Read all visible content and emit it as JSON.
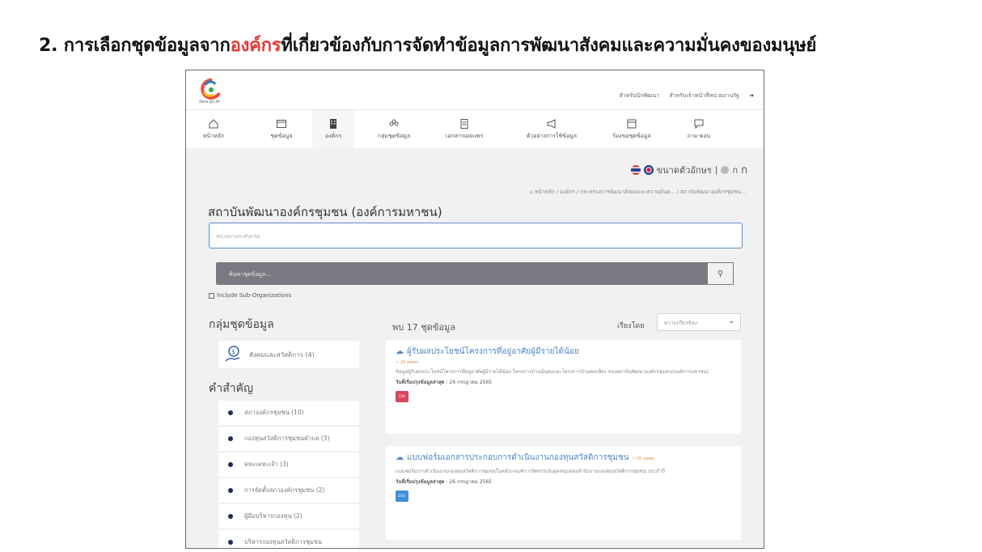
{
  "slide": {
    "title_prefix": "2. การเลือกชุดข้อมูลจาก",
    "title_highlight": "องค์กร",
    "title_suffix": "ที่เกี่ยวข้องกับการจัดทำข้อมูลการพัฒนาสังคมและความมั่นคงของมนุษย์",
    "highlight_color": "#e53935"
  },
  "site": {
    "logo_text": "data.go.th",
    "top_links": [
      "สำหรับนักพัฒนา",
      "สำหรับเจ้าหน้าที่หน่วยงานรัฐ"
    ]
  },
  "nav": {
    "items": [
      {
        "label": "หน้าหลัก",
        "icon": "home-icon"
      },
      {
        "label": "ชุดข้อมูล",
        "icon": "dataset-icon"
      },
      {
        "label": "องค์กร",
        "icon": "building-icon"
      },
      {
        "label": "กลุ่มชุดข้อมูล",
        "icon": "group-icon"
      },
      {
        "label": "เอกสารเผยแพร่",
        "icon": "document-icon"
      },
      {
        "label": "ตัวอย่างการใช้ข้อมูล",
        "icon": "megaphone-icon"
      },
      {
        "label": "ร้องขอชุดข้อมูล",
        "icon": "request-icon"
      },
      {
        "label": "ถาม-ตอบ",
        "icon": "chat-icon"
      }
    ]
  },
  "font_size": {
    "label": "ขนาดตัวอักษร",
    "small": "ก",
    "large": "ก"
  },
  "breadcrumb": [
    "หน้าหลัก",
    "องค์กร",
    "กระทรวงการพัฒนาสังคมและความมั่นค...",
    "สถาบันพัฒนาองค์กรชุมชน..."
  ],
  "org": {
    "title": "สถาบันพัฒนาองค์กรชุมชน (องค์การมหาชน)",
    "agency_placeholder": "หน่วยงานระดับกรม"
  },
  "search": {
    "placeholder": "ค้นหาชุดข้อมูล...",
    "include_sub": "Include Sub-Organizations"
  },
  "groups": {
    "heading": "กลุ่มชุดข้อมูล",
    "items": [
      {
        "label": "สังคมและสวัสดิการ (4)"
      }
    ]
  },
  "keywords": {
    "heading": "คำสำคัญ",
    "items": [
      "สภาองค์กรชุมชน (10)",
      "กองทุนสวัสดิการชุมชนตำบล (3)",
      "คหะเคหะเจ้า (3)",
      "การจัดตั้งสภาองค์กรชุมชน (2)",
      "ผู้มีอบริหารกองทุน (2)",
      "บริหารกองทุนสวัสดิการชุมชน"
    ]
  },
  "results": {
    "count_text": "พบ 17 ชุดข้อมูล",
    "sort_label": "เรียงโดย",
    "sort_value": "ความเกี่ยวข้อง",
    "cards": [
      {
        "title": "ผู้รับผลประโยชน์โครงการที่อยู่อาศัยผู้มีรายได้น้อย",
        "views": "25 views",
        "desc": "ข้อมูลผู้รับผลประโยชน์โครงการที่อยู่อาศัยผู้มีรายได้น้อย โครงการบ้านมั่นคงและโครงการบ้านพอเพียง ของสถาบันพัฒนาองค์กรชุมชน(องค์การมหาชน)",
        "date_label": "วันที่เริ่มปรุงข้อมูลล่าสุด",
        "date": "26 กรกฎาคม 2565",
        "format": "CSV"
      },
      {
        "title": "แบบฟอร์มเอกสารประกอบการดำเนินงานกองทุนสวัสดิการชุมชน",
        "views": "15 views",
        "desc": "แบบฟอร์มการดำเนินงานกองทุนสวัสดิการชุมชนในหลักเกณฑ์การจัดสรรเงินอุดหนุนของสำนักงานกองทุนสวัสดิการชุมชน ประจำปี",
        "date_label": "วันที่เริ่มปรุงข้อมูลล่าสุด",
        "date": "26 กรกฎาคม 2565",
        "format": "DOC"
      }
    ]
  }
}
